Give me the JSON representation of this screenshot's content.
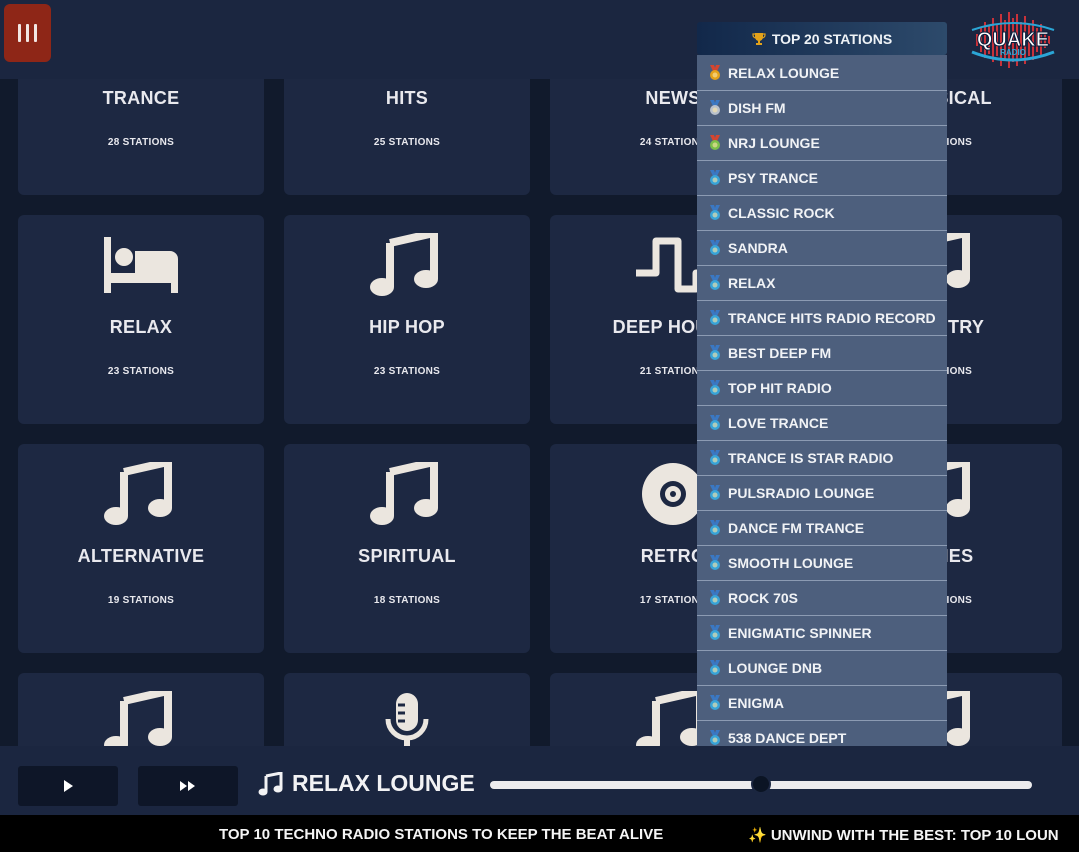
{
  "header": {
    "menu_icon": "menu-bars-icon",
    "logo_text": "QUAKE",
    "logo_sub": "RADIO"
  },
  "top_stations": {
    "button_label": "TOP 20 STATIONS",
    "icon": "trophy-icon",
    "items": [
      {
        "label": "RELAX LOUNGE",
        "medal": "gold"
      },
      {
        "label": "DISH FM",
        "medal": "silver"
      },
      {
        "label": "NRJ LOUNGE",
        "medal": "bronze"
      },
      {
        "label": "PSY TRANCE",
        "medal": "blue"
      },
      {
        "label": "CLASSIC ROCK",
        "medal": "blue"
      },
      {
        "label": "SANDRA",
        "medal": "blue"
      },
      {
        "label": "RELAX",
        "medal": "blue"
      },
      {
        "label": "TRANCE HITS RADIO RECORD",
        "medal": "blue"
      },
      {
        "label": "BEST DEEP FM",
        "medal": "blue"
      },
      {
        "label": "TOP HIT RADIO",
        "medal": "blue"
      },
      {
        "label": "LOVE TRANCE",
        "medal": "blue"
      },
      {
        "label": "TRANCE IS STAR RADIO",
        "medal": "blue"
      },
      {
        "label": "PULSRADIO LOUNGE",
        "medal": "blue"
      },
      {
        "label": "DANCE FM TRANCE",
        "medal": "blue"
      },
      {
        "label": "SMOOTH LOUNGE",
        "medal": "blue"
      },
      {
        "label": "ROCK 70S",
        "medal": "blue"
      },
      {
        "label": "ENIGMATIC SPINNER",
        "medal": "blue"
      },
      {
        "label": "LOUNGE DNB",
        "medal": "blue"
      },
      {
        "label": "ENIGMA",
        "medal": "blue"
      },
      {
        "label": "538 DANCE DEPT",
        "medal": "blue"
      }
    ]
  },
  "genres": [
    {
      "title": "TRANCE",
      "count": "28 STATIONS",
      "icon": "none"
    },
    {
      "title": "HITS",
      "count": "25 STATIONS",
      "icon": "none"
    },
    {
      "title": "NEWS",
      "count": "24 STATIONS",
      "icon": "none"
    },
    {
      "title": "CLASSICAL",
      "count": "24 STATIONS",
      "icon": "none"
    },
    {
      "title": "RELAX",
      "count": "23 STATIONS",
      "icon": "bed-icon"
    },
    {
      "title": "HIP HOP",
      "count": "23 STATIONS",
      "icon": "music-note-icon"
    },
    {
      "title": "DEEP HOUSE",
      "count": "21 STATIONS",
      "icon": "square-wave-icon"
    },
    {
      "title": "COUNTRY",
      "count": "21 STATIONS",
      "icon": "music-note-icon"
    },
    {
      "title": "ALTERNATIVE",
      "count": "19 STATIONS",
      "icon": "music-note-icon"
    },
    {
      "title": "SPIRITUAL",
      "count": "18 STATIONS",
      "icon": "music-note-icon"
    },
    {
      "title": "RETRO",
      "count": "17 STATIONS",
      "icon": "vinyl-record-icon"
    },
    {
      "title": "OLDIES",
      "count": "17 STATIONS",
      "icon": "music-note-icon"
    },
    {
      "title": "",
      "count": "",
      "icon": "music-note-icon"
    },
    {
      "title": "",
      "count": "",
      "icon": "microphone-icon"
    },
    {
      "title": "",
      "count": "",
      "icon": "music-note-icon"
    },
    {
      "title": "",
      "count": "",
      "icon": "music-note-icon"
    }
  ],
  "player": {
    "play_icon": "play-icon",
    "next_icon": "fast-forward-icon",
    "now_playing_icon": "music-note-icon",
    "now_playing": "RELAX LOUNGE",
    "volume": 0.5
  },
  "ticker": {
    "items": [
      "TOP 10 TECHNO RADIO STATIONS TO KEEP THE BEAT ALIVE",
      "✨ UNWIND WITH THE BEST: TOP 10 LOUN"
    ]
  }
}
